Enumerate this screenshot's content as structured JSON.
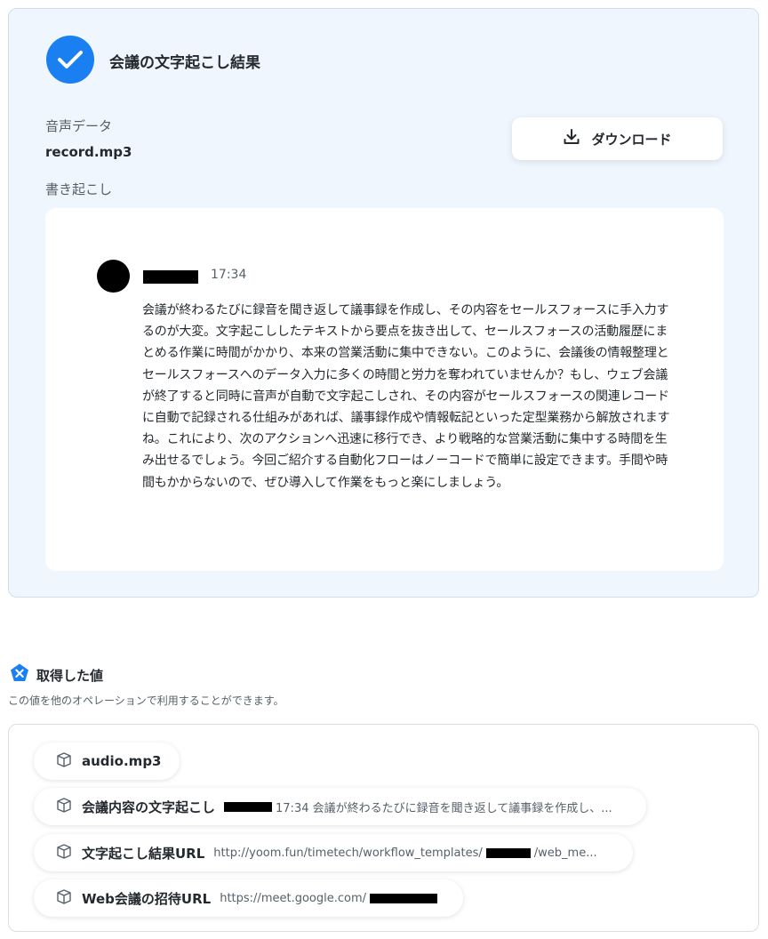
{
  "result": {
    "title": "会議の文字起こし結果",
    "audio_label": "音声データ",
    "audio_file": "record.mp3",
    "download_label": "ダウンロード",
    "transcript_label": "書き起こし",
    "speaker_time": "17:34",
    "transcript_text": "会議が終わるたびに録音を聞き返して議事録を作成し、その内容をセールスフォースに手入力するのが大変。文字起こししたテキストから要点を抜き出して、セールスフォースの活動履歴にまとめる作業に時間がかかり、本来の営業活動に集中できない。このように、会議後の情報整理とセールスフォースへのデータ入力に多くの時間と労力を奪われていませんか？もし、ウェブ会議が終了すると同時に音声が自動で文字起こしされ、その内容がセールスフォースの関連レコードに自動で記録される仕組みがあれば、議事録作成や情報転記といった定型業務から解放されますね。これにより、次のアクションへ迅速に移行でき、より戦略的な営業活動に集中する時間を生み出せるでしょう。今回ご紹介する自動化フローはノーコードで簡単に設定できます。手間や時間もかからないので、ぜひ導入して作業をもっと楽にしましょう。"
  },
  "values": {
    "title": "取得した値",
    "description": "この値を他のオペレーションで利用することができます。",
    "items": [
      {
        "label": "audio.mp3",
        "value_prefix": "",
        "value_suffix": ""
      },
      {
        "label": "会議内容の文字起こし",
        "value_prefix": "",
        "value_suffix": "17:34 会議が終わるたびに録音を聞き返して議事録を作成し、..."
      },
      {
        "label": "文字起こし結果URL",
        "value_prefix": "http://yoom.fun/timetech/workflow_templates/",
        "value_suffix": "/web_me..."
      },
      {
        "label": "Web会議の招待URL",
        "value_prefix": "https://meet.google.com/",
        "value_suffix": ""
      }
    ]
  },
  "colors": {
    "accent": "#1a7ff0",
    "card_bg": "#eff6fd"
  },
  "icons": {
    "check": "check-icon",
    "download": "download-icon",
    "values": "yoom-badge-icon",
    "value_item": "value-cube-icon"
  }
}
